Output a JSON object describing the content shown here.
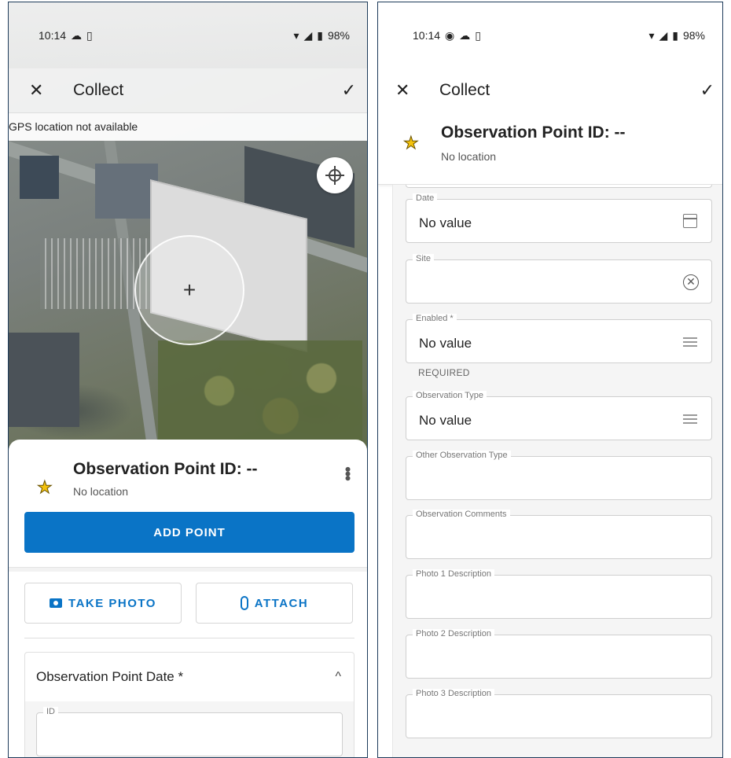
{
  "left": {
    "status": {
      "time": "10:14",
      "battery": "98%"
    },
    "appbar": {
      "close": "✕",
      "title": "Collect",
      "confirm": "✓"
    },
    "gps_banner": "GPS location not available",
    "reticle_symbol": "+",
    "feature": {
      "title": "Observation Point ID: --",
      "subtitle": "No location",
      "more": "⋮"
    },
    "add_point_label": "ADD POINT",
    "take_photo_label": "TAKE PHOTO",
    "attach_label": "ATTACH",
    "section": {
      "title": "Observation Point Date *",
      "chevron": "^",
      "field_label": "ID"
    }
  },
  "right": {
    "status": {
      "time": "10:14",
      "battery": "98%"
    },
    "appbar": {
      "close": "✕",
      "title": "Collect",
      "confirm": "✓"
    },
    "feature": {
      "title": "Observation Point ID: --",
      "subtitle": "No location"
    },
    "fields": {
      "date": {
        "label": "Date",
        "value": "No value"
      },
      "site": {
        "label": "Site",
        "value": ""
      },
      "enabled": {
        "label": "Enabled *",
        "value": "No value",
        "helper": "REQUIRED"
      },
      "observation_type": {
        "label": "Observation Type",
        "value": "No value"
      },
      "other_observation_type": {
        "label": "Other Observation Type",
        "value": ""
      },
      "observation_comments": {
        "label": "Observation Comments",
        "value": ""
      },
      "photo1": {
        "label": "Photo 1 Description",
        "value": ""
      },
      "photo2": {
        "label": "Photo 2 Description",
        "value": ""
      },
      "photo3": {
        "label": "Photo 3 Description",
        "value": ""
      }
    }
  },
  "colors": {
    "accent": "#0a74c6",
    "star": "#f4c20d",
    "frame": "#1d3b5a"
  },
  "icons": [
    "cloud-icon",
    "sim-icon",
    "wifi-icon",
    "signal-icon",
    "battery-icon",
    "close-icon",
    "check-icon",
    "locate-icon",
    "star-icon",
    "more-icon",
    "camera-icon",
    "paperclip-icon",
    "chevron-up-icon",
    "calendar-icon",
    "clear-icon",
    "list-icon"
  ]
}
